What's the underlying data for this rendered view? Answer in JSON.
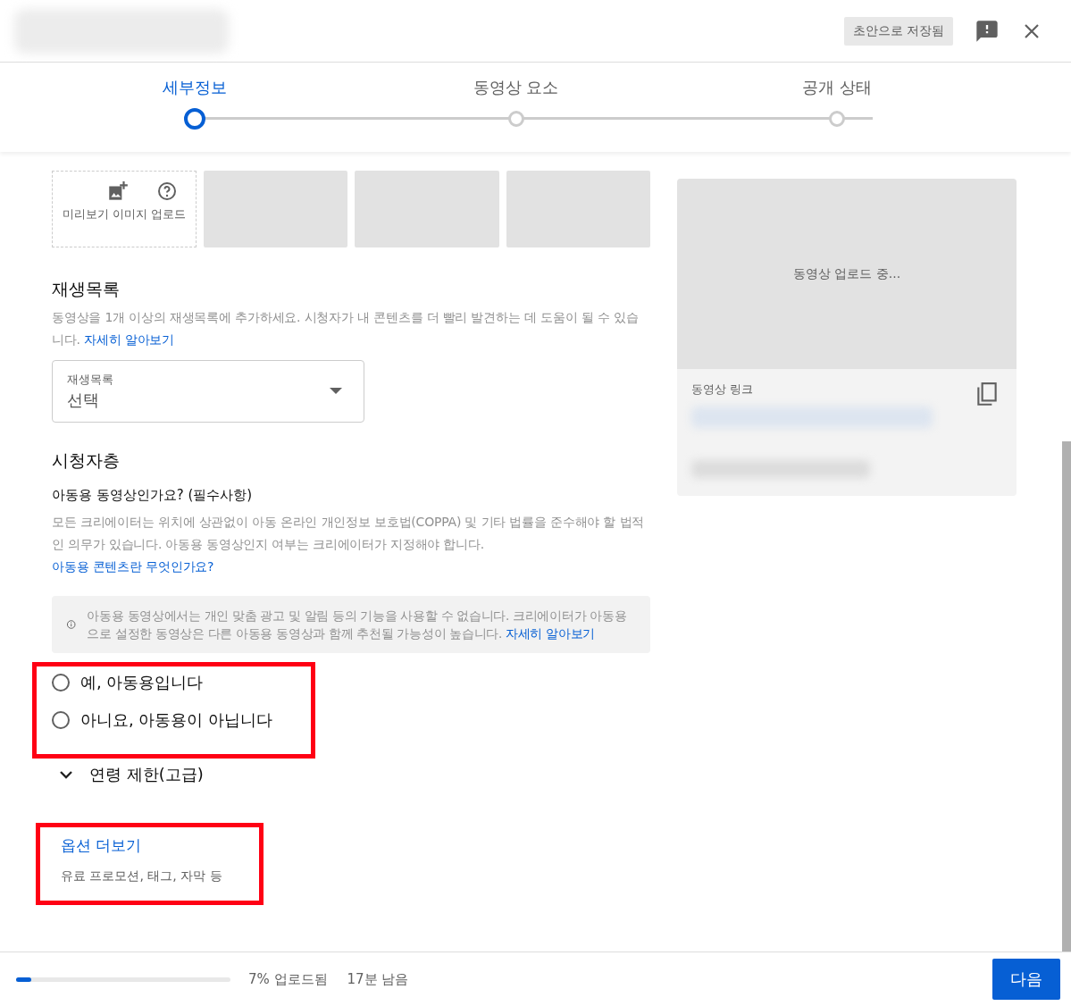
{
  "header": {
    "save_status": "초안으로 저장됨"
  },
  "steps": [
    {
      "label": "세부정보",
      "selected": true
    },
    {
      "label": "동영상 요소",
      "selected": false
    },
    {
      "label": "공개 상태",
      "selected": false
    }
  ],
  "thumbnail": {
    "upload_label": "미리보기 이미지 업로드"
  },
  "playlist": {
    "heading": "재생목록",
    "description": "동영상을 1개 이상의 재생목록에 추가하세요. 시청자가 내 콘텐츠를 더 빨리 발견하는 데 도움이 될 수 있습니다.",
    "link": "자세히 알아보기",
    "field_label": "재생목록",
    "field_value": "선택"
  },
  "audience": {
    "heading": "시청자층",
    "question": "아동용 동영상인가요? (필수사항)",
    "description": "모든 크리에이터는 위치에 상관없이 아동 온라인 개인정보 보호법(COPPA) 및 기타 법률을 준수해야 할 법적인 의무가 있습니다. 아동용 동영상인지 여부는 크리에이터가 지정해야 합니다.",
    "link": "아동용 콘텐츠란 무엇인가요?",
    "notice": "아동용 동영상에서는 개인 맞춤 광고 및 알림 등의 기능을 사용할 수 없습니다. 크리에이터가 아동용으로 설정한 동영상은 다른 아동용 동영상과 함께 추천될 가능성이 높습니다.",
    "notice_link": "자세히 알아보기",
    "options": [
      {
        "label": "예, 아동용입니다",
        "checked": false
      },
      {
        "label": "아니요, 아동용이 아닙니다",
        "checked": false
      }
    ]
  },
  "age_restriction": {
    "label": "연령 제한(고급)",
    "expanded": false
  },
  "more_options": {
    "label": "옵션 더보기",
    "subtitle": "유료 프로모션, 태그, 자막 등"
  },
  "preview": {
    "status": "동영상 업로드 중...",
    "link_label": "동영상 링크"
  },
  "footer": {
    "level": 0.07,
    "progress_text": "7% 업로드됨",
    "time_left": "17분 남음",
    "next_button": "다음"
  }
}
